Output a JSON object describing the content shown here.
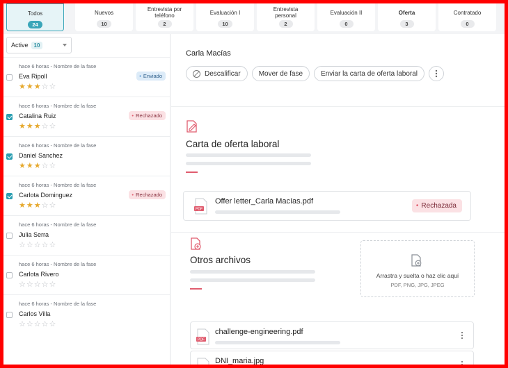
{
  "stages": [
    {
      "label": "Todos",
      "count": "24",
      "active": true
    },
    {
      "label": "Nuevos",
      "count": "10"
    },
    {
      "label": "Entrevista por teléfono",
      "count": "2"
    },
    {
      "label": "Evaluación I",
      "count": "10"
    },
    {
      "label": "Entrevista personal",
      "count": "2"
    },
    {
      "label": "Evaluación II",
      "count": "0"
    },
    {
      "label": "Oferta",
      "count": "3",
      "bold": true
    },
    {
      "label": "Contratado",
      "count": "0"
    }
  ],
  "filter": {
    "label": "Active",
    "count": "10"
  },
  "candidates": [
    {
      "meta": "hace 6 horas - Nombre de la fase",
      "name": "Eva Ripoll",
      "rating": 3,
      "checked": false,
      "tag": "Enviado",
      "tag_type": "enviado"
    },
    {
      "meta": "hace 6 horas - Nombre de la fase",
      "name": "Catalina Ruiz",
      "rating": 3,
      "checked": true,
      "tag": "Rechazado",
      "tag_type": "rechazado"
    },
    {
      "meta": "hace 6 horas - Nombre de la fase",
      "name": "Daniel Sanchez",
      "rating": 3,
      "checked": true,
      "tag": "",
      "tag_type": ""
    },
    {
      "meta": "hace 6 horas - Nombre de la fase",
      "name": "Carlota Dominguez",
      "rating": 3,
      "checked": true,
      "tag": "Rechazado",
      "tag_type": "rechazado"
    },
    {
      "meta": "hace 6 horas - Nombre de la fase",
      "name": "Julia Serra",
      "rating": 0,
      "checked": false,
      "tag": "",
      "tag_type": ""
    },
    {
      "meta": "hace 6 horas - Nombre de la fase",
      "name": "Carlota Rivero",
      "rating": 0,
      "checked": false,
      "tag": "",
      "tag_type": ""
    },
    {
      "meta": "hace 6 horas - Nombre de la fase",
      "name": "Carlos Villa",
      "rating": 0,
      "checked": false,
      "tag": "",
      "tag_type": ""
    }
  ],
  "detail": {
    "candidate_name": "Carla Macías",
    "actions": {
      "disqualify": "Descalificar",
      "move_stage": "Mover de fase",
      "send_offer": "Enviar la carta de oferta laboral"
    },
    "offer_section": {
      "title": "Carta de oferta laboral",
      "file_name": "Offer letter_Carla Macías.pdf",
      "file_type": "PDF",
      "status": "Rechazada"
    },
    "other_files": {
      "title": "Otros archivos",
      "dropzone_main": "Arrastra y suelta o haz clic aquí",
      "dropzone_sub": "PDF, PNG, JPG, JPEG",
      "files": [
        {
          "name": "challenge-engineering.pdf",
          "type": "PDF"
        },
        {
          "name": "DNI_maria.jpg",
          "type": "JPG"
        }
      ]
    }
  },
  "colors": {
    "accent": "#3aa6b9",
    "danger": "#e05c6e",
    "star": "#e6a82c",
    "border_frame": "#ff0000"
  }
}
